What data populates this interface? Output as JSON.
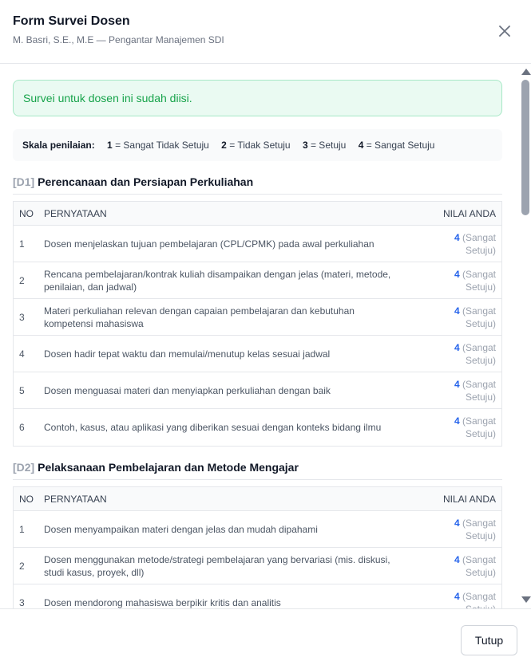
{
  "header": {
    "title": "Form Survei Dosen",
    "subtitle": "M. Basri, S.E., M.E — Pengantar Manajemen SDI"
  },
  "alert": {
    "text": "Survei untuk dosen ini sudah diisi."
  },
  "scale": {
    "lead": "Skala penilaian:",
    "items": [
      {
        "num": "1",
        "label": "= Sangat Tidak Setuju"
      },
      {
        "num": "2",
        "label": "= Tidak Setuju"
      },
      {
        "num": "3",
        "label": "= Setuju"
      },
      {
        "num": "4",
        "label": "= Sangat Setuju"
      }
    ]
  },
  "columns": {
    "no": "NO",
    "statement": "PERNYATAAN",
    "value": "NILAI ANDA"
  },
  "sections": [
    {
      "code": "[D1]",
      "title": "Perencanaan dan Persiapan Perkuliahan",
      "rows": [
        {
          "no": "1",
          "statement": "Dosen menjelaskan tujuan pembelajaran (CPL/CPMK) pada awal perkuliahan",
          "value": "4",
          "value_label": "(Sangat Setuju)"
        },
        {
          "no": "2",
          "statement": "Rencana pembelajaran/kontrak kuliah disampaikan dengan jelas (materi, metode, penilaian, dan jadwal)",
          "value": "4",
          "value_label": "(Sangat Setuju)"
        },
        {
          "no": "3",
          "statement": "Materi perkuliahan relevan dengan capaian pembelajaran dan kebutuhan kompetensi mahasiswa",
          "value": "4",
          "value_label": "(Sangat Setuju)"
        },
        {
          "no": "4",
          "statement": "Dosen hadir tepat waktu dan memulai/menutup kelas sesuai jadwal",
          "value": "4",
          "value_label": "(Sangat Setuju)"
        },
        {
          "no": "5",
          "statement": "Dosen menguasai materi dan menyiapkan perkuliahan dengan baik",
          "value": "4",
          "value_label": "(Sangat Setuju)"
        },
        {
          "no": "6",
          "statement": "Contoh, kasus, atau aplikasi yang diberikan sesuai dengan konteks bidang ilmu",
          "value": "4",
          "value_label": "(Sangat Setuju)"
        }
      ]
    },
    {
      "code": "[D2]",
      "title": "Pelaksanaan Pembelajaran dan Metode Mengajar",
      "rows": [
        {
          "no": "1",
          "statement": "Dosen menyampaikan materi dengan jelas dan mudah dipahami",
          "value": "4",
          "value_label": "(Sangat Setuju)"
        },
        {
          "no": "2",
          "statement": "Dosen menggunakan metode/strategi pembelajaran yang bervariasi (mis. diskusi, studi kasus, proyek, dll)",
          "value": "4",
          "value_label": "(Sangat Setuju)"
        },
        {
          "no": "3",
          "statement": "Dosen mendorong mahasiswa berpikir kritis dan analitis",
          "value": "4",
          "value_label": "(Sangat Setuju)"
        }
      ]
    }
  ],
  "footer": {
    "close_label": "Tutup"
  },
  "icons": {
    "close": "close-icon"
  },
  "colors": {
    "accent": "#2563eb",
    "success_text": "#16a34a",
    "success_bg": "#eafaf2",
    "success_border": "#a7e8c6"
  }
}
